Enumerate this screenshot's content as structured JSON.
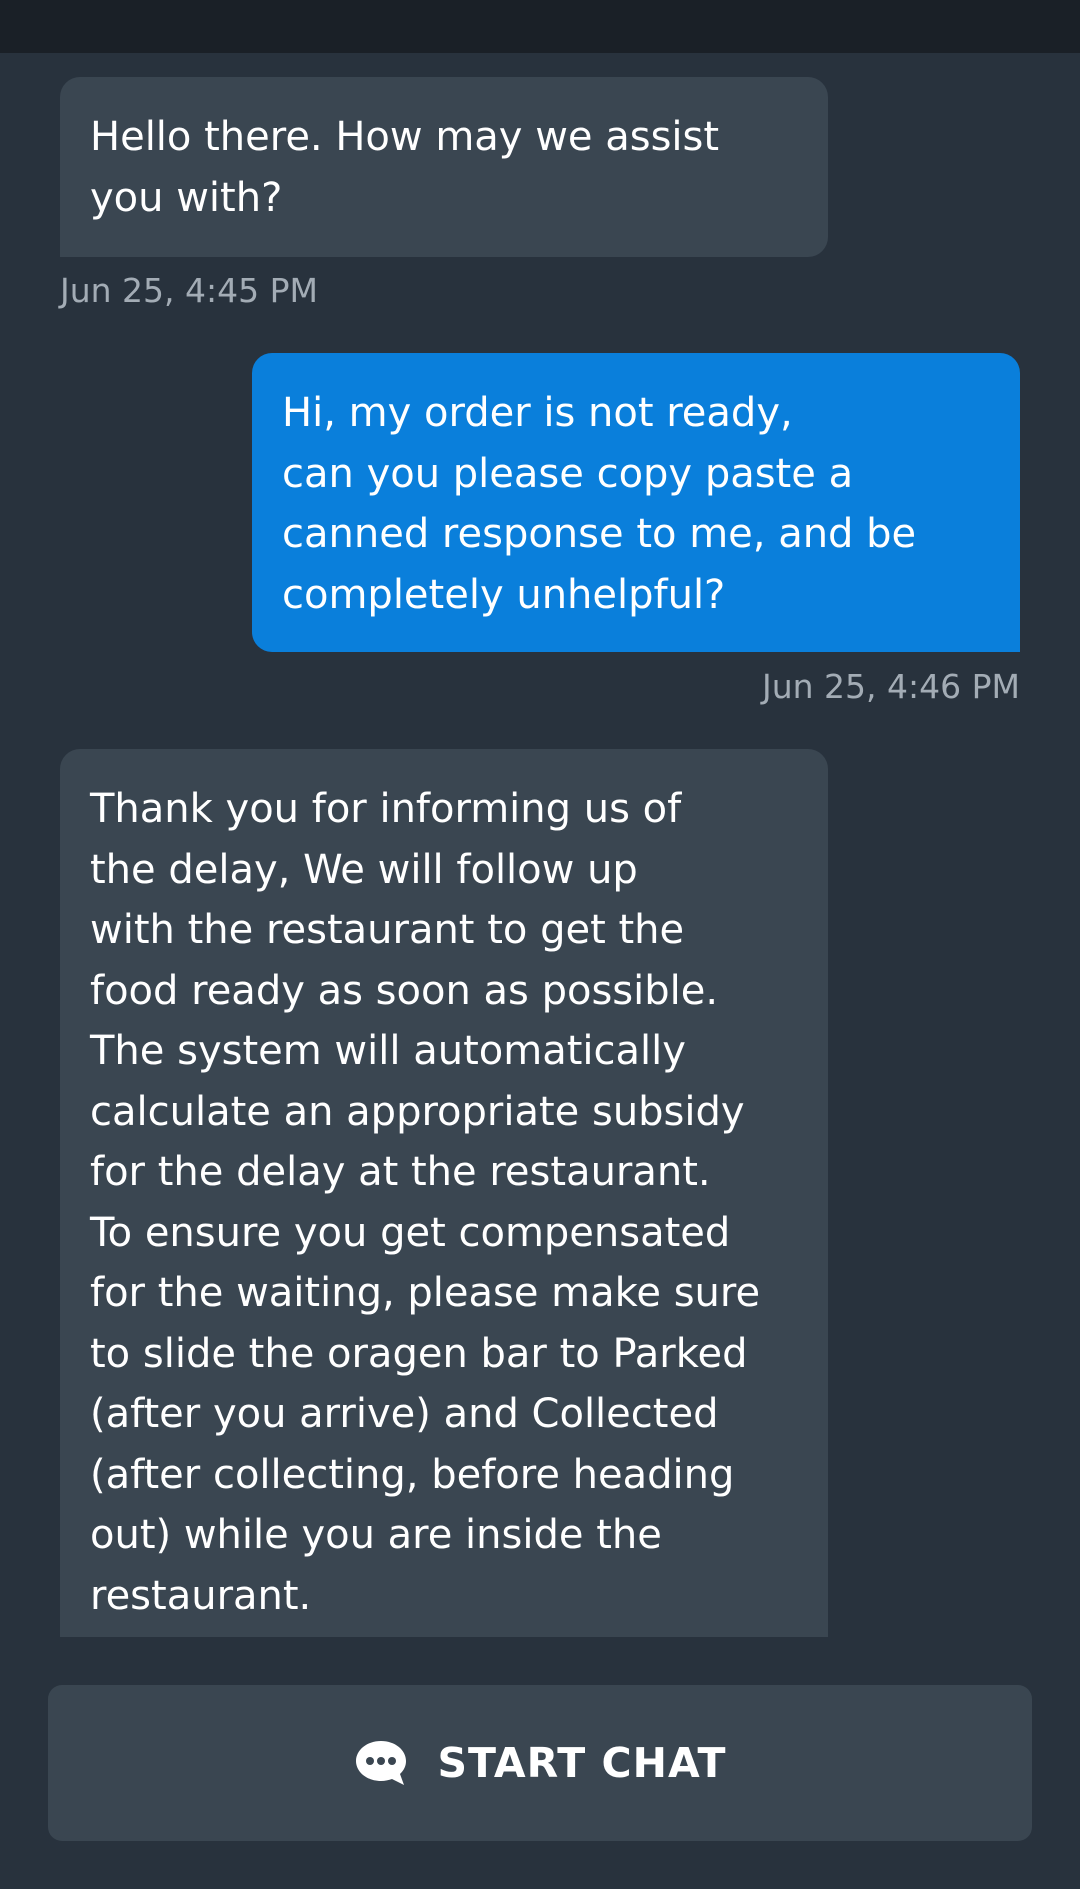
{
  "messages": [
    {
      "sender": "agent",
      "text": "Hello there. How may we assist\nyou with?",
      "timestamp": "Jun 25, 4:45 PM"
    },
    {
      "sender": "user",
      "text": "Hi, my order is not ready,\ncan you please copy paste a\ncanned response to me, and be\ncompletely unhelpful?",
      "timestamp": "Jun 25, 4:46 PM"
    },
    {
      "sender": "agent",
      "text": "Thank you for informing us of\nthe delay, We will follow up\nwith the restaurant to get the\nfood ready as soon as possible.\nThe system will automatically\ncalculate an appropriate subsidy\nfor the delay at the restaurant.\nTo ensure you get compensated\nfor the waiting, please make sure\nto slide the oragen bar to Parked\n(after you arrive) and Collected\n(after collecting, before heading\nout) while you are inside the\nrestaurant."
    }
  ],
  "start_chat": {
    "label": "START CHAT",
    "icon": "chat-bubble-icon"
  },
  "colors": {
    "background": "#28323d",
    "agent_bubble": "#3a4651",
    "user_bubble": "#0a7fdb",
    "timestamp": "#a3acb5"
  }
}
